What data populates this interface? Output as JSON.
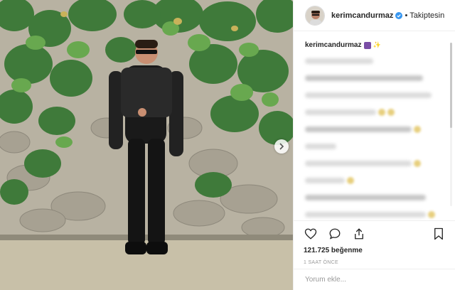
{
  "post": {
    "photo_alt": "",
    "next_icon": "chevron-right-icon"
  },
  "header": {
    "username": "kerimcandurmaz",
    "verified_icon": "verified-badge-icon",
    "separator": "•",
    "follow_status": "Takiptesin"
  },
  "caption": {
    "username": "kerimcandurmaz",
    "emoji_b": "✨"
  },
  "actions": {
    "like_icon": "heart-icon",
    "comment_icon": "comment-icon",
    "share_icon": "share-icon",
    "save_icon": "bookmark-icon",
    "likes_text": "121.725 beğenme",
    "time_text": "1 SAAT ÖNCE"
  },
  "add_comment": {
    "placeholder": "Yorum ekle..."
  },
  "colors": {
    "text": "#262626",
    "muted": "#999999",
    "verified": "#3897f0",
    "border": "#efefef"
  }
}
